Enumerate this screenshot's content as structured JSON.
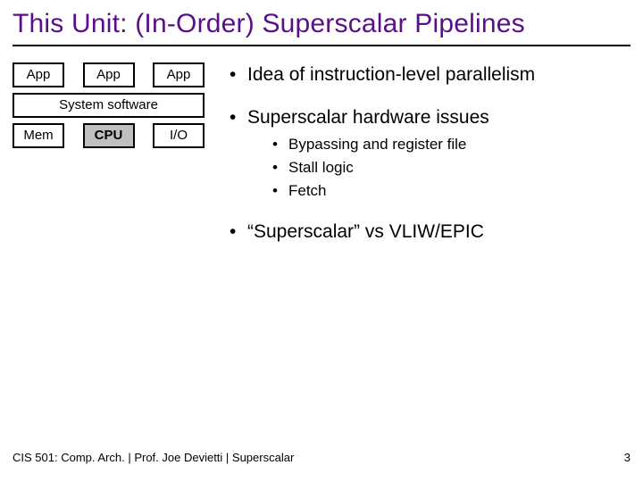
{
  "title": "This Unit: (In-Order) Superscalar Pipelines",
  "diagram": {
    "app1": "App",
    "app2": "App",
    "app3": "App",
    "sys": "System software",
    "mem": "Mem",
    "cpu": "CPU",
    "io": "I/O"
  },
  "bullets": {
    "b1": "Idea of instruction-level parallelism",
    "b2": "Superscalar hardware issues",
    "b2a": "Bypassing and register file",
    "b2b": "Stall logic",
    "b2c": "Fetch",
    "b3": "“Superscalar” vs VLIW/EPIC"
  },
  "footer": {
    "left": "CIS 501: Comp. Arch.  |  Prof. Joe Devietti  |  Superscalar",
    "page": "3"
  }
}
